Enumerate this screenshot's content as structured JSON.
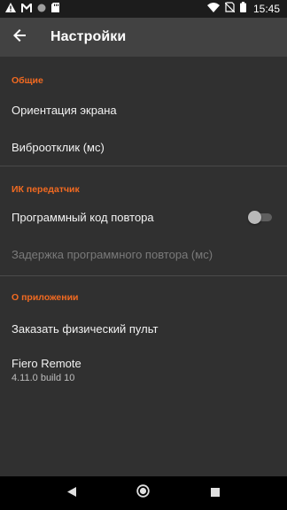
{
  "status_bar": {
    "time": "15:45",
    "icons_left": [
      "warning-icon",
      "gmail-icon",
      "circle-icon",
      "sd-card-icon"
    ],
    "icons_right": [
      "wifi-icon",
      "no-sim-icon",
      "battery-icon"
    ]
  },
  "toolbar": {
    "title": "Настройки",
    "back_icon": "arrow-back-icon"
  },
  "sections": {
    "general": {
      "title": "Общие",
      "items": {
        "screen_orientation": "Ориентация экрана",
        "vibro": "Виброотклик (мс)"
      }
    },
    "ir": {
      "title": "ИК передатчик",
      "items": {
        "repeat_code": "Программный код повтора",
        "repeat_code_enabled": false,
        "repeat_delay": "Задержка программного повтора (мс)"
      }
    },
    "about": {
      "title": "О приложении",
      "items": {
        "order_remote": "Заказать физический пульт",
        "app_name": "Fiero Remote",
        "app_version": "4.11.0 build 10"
      }
    }
  },
  "colors": {
    "accent": "#f26a21",
    "background": "#303030",
    "toolbar": "#424242",
    "status_bar": "#1c1c1c",
    "nav_bar": "#000000"
  },
  "nav_bar": {
    "buttons": [
      "back-triangle-icon",
      "home-circle-icon",
      "recents-square-icon"
    ]
  }
}
